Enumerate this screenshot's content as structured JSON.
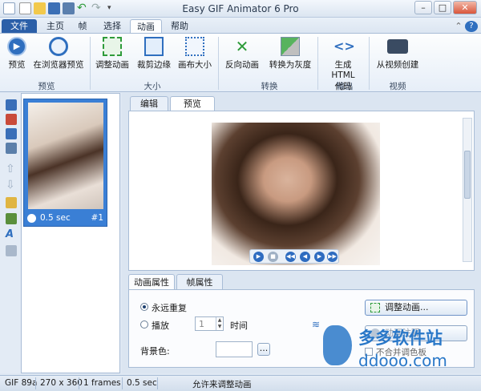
{
  "app": {
    "title": "Easy GIF Animator 6 Pro"
  },
  "menu": {
    "file": "文件",
    "home": "主页",
    "frame": "帧",
    "select": "选择",
    "animation": "动画",
    "help": "帮助"
  },
  "ribbon": {
    "preview": "预览",
    "preview_browser": "在浏览器预览",
    "resize_animation": "调整动画",
    "crop": "裁剪边缘",
    "canvas_size": "画布大小",
    "reverse": "反向动画",
    "grayscale": "转换为灰度",
    "html_code_line1": "生成 HTML",
    "html_code_line2": "代码",
    "from_video": "从视频创建",
    "group_preview": "预览",
    "group_size": "大小",
    "group_convert": "转换",
    "group_output": "输出",
    "group_video": "视频"
  },
  "frames": [
    {
      "duration": "0.5 sec",
      "index": "#1"
    }
  ],
  "tabs": {
    "edit": "编辑",
    "preview": "预览"
  },
  "props": {
    "tab_animation": "动画属性",
    "tab_frame": "帧属性",
    "repeat_forever": "永远重复",
    "play": "播放",
    "play_count": "1",
    "times": "时间",
    "bgcolor": "背景色:",
    "browse": "...",
    "resize_btn": "调整动画...",
    "comment_btn": "动画注释",
    "no_merge": "不合并调色板"
  },
  "status": {
    "format": "GIF 89a",
    "size": "270 x 360",
    "frames": "1 frames",
    "duration": "0.5 sec",
    "hint": "允许来调整动画"
  },
  "watermark": {
    "name": "多多软件站",
    "url": "ddooo.com"
  },
  "colors": {
    "accent": "#2b5fa8",
    "selection": "#3a7fd5",
    "icon_green": "#2e9b3a",
    "icon_blue": "#2f6fbf"
  }
}
